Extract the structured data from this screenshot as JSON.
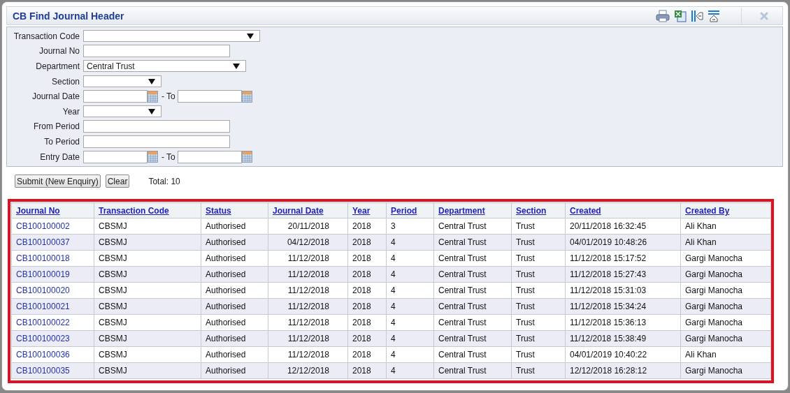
{
  "window": {
    "title": "CB Find Journal Header"
  },
  "form": {
    "fields": [
      {
        "label": "Transaction Code",
        "kind": "select"
      },
      {
        "label": "Journal No",
        "kind": "text"
      },
      {
        "label": "Department",
        "kind": "select",
        "value": "Central Trust"
      },
      {
        "label": "Section",
        "kind": "select"
      },
      {
        "label": "Journal Date",
        "kind": "date",
        "to_label": "- To"
      },
      {
        "label": "Year",
        "kind": "select"
      },
      {
        "label": "From Period",
        "kind": "text"
      },
      {
        "label": "To Period",
        "kind": "text"
      },
      {
        "label": "Entry Date",
        "kind": "date",
        "to_label": "- To"
      }
    ]
  },
  "buttons": [
    "Submit (New Enquiry)",
    "Clear"
  ],
  "total": "Total: 10",
  "table": {
    "columns": [
      "Journal No",
      "Transaction Code",
      "Status",
      "Journal Date",
      "Year",
      "Period",
      "Department",
      "Section",
      "Created",
      "Created By"
    ],
    "rows": [
      [
        "CB100100002",
        "CBSMJ",
        "Authorised",
        "20/11/2018",
        "2018",
        "3",
        "Central Trust",
        "Trust",
        "20/11/2018 16:32:45",
        "Ali Khan"
      ],
      [
        "CB100100037",
        "CBSMJ",
        "Authorised",
        "04/12/2018",
        "2018",
        "4",
        "Central Trust",
        "Trust",
        "04/01/2019 10:48:26",
        "Ali Khan"
      ],
      [
        "CB100100018",
        "CBSMJ",
        "Authorised",
        "11/12/2018",
        "2018",
        "4",
        "Central Trust",
        "Trust",
        "11/12/2018 15:17:52",
        "Gargi Manocha"
      ],
      [
        "CB100100019",
        "CBSMJ",
        "Authorised",
        "11/12/2018",
        "2018",
        "4",
        "Central Trust",
        "Trust",
        "11/12/2018 15:27:43",
        "Gargi Manocha"
      ],
      [
        "CB100100020",
        "CBSMJ",
        "Authorised",
        "11/12/2018",
        "2018",
        "4",
        "Central Trust",
        "Trust",
        "11/12/2018 15:31:03",
        "Gargi Manocha"
      ],
      [
        "CB100100021",
        "CBSMJ",
        "Authorised",
        "11/12/2018",
        "2018",
        "4",
        "Central Trust",
        "Trust",
        "11/12/2018 15:34:24",
        "Gargi Manocha"
      ],
      [
        "CB100100022",
        "CBSMJ",
        "Authorised",
        "11/12/2018",
        "2018",
        "4",
        "Central Trust",
        "Trust",
        "11/12/2018 15:36:13",
        "Gargi Manocha"
      ],
      [
        "CB100100023",
        "CBSMJ",
        "Authorised",
        "11/12/2018",
        "2018",
        "4",
        "Central Trust",
        "Trust",
        "11/12/2018 15:38:49",
        "Gargi Manocha"
      ],
      [
        "CB100100036",
        "CBSMJ",
        "Authorised",
        "11/12/2018",
        "2018",
        "4",
        "Central Trust",
        "Trust",
        "04/01/2019 10:40:22",
        "Ali Khan"
      ],
      [
        "CB100100035",
        "CBSMJ",
        "Authorised",
        "12/12/2018",
        "2018",
        "4",
        "Central Trust",
        "Trust",
        "12/12/2018 16:28:12",
        "Gargi Manocha"
      ]
    ]
  }
}
